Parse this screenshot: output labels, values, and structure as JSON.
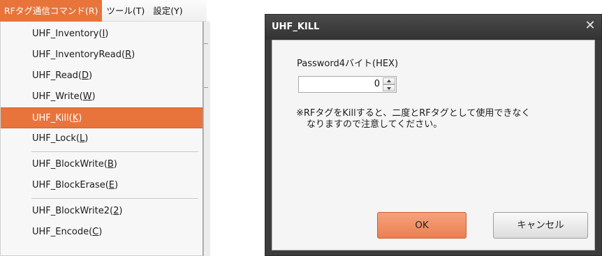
{
  "menubar": {
    "items": [
      {
        "label": "RFタグ通信コマンド(R)"
      },
      {
        "label": "ツール(T)"
      },
      {
        "label": "設定(Y)"
      }
    ]
  },
  "dropdown": {
    "items": [
      {
        "name": "UHF_Inventory(",
        "key": "I",
        "tail": ")"
      },
      {
        "name": "UHF_InventoryRead(",
        "key": "R",
        "tail": ")"
      },
      {
        "name": "UHF_Read(",
        "key": "D",
        "tail": ")"
      },
      {
        "name": "UHF_Write(",
        "key": "W",
        "tail": ")"
      },
      {
        "name": "UHF_Kill(",
        "key": "K",
        "tail": ")"
      },
      {
        "name": "UHF_Lock(",
        "key": "L",
        "tail": ")"
      },
      {
        "name": "UHF_BlockWrite(",
        "key": "B",
        "tail": ")"
      },
      {
        "name": "UHF_BlockErase(",
        "key": "E",
        "tail": ")"
      },
      {
        "name": "UHF_BlockWrite2(",
        "key": "2",
        "tail": ")"
      },
      {
        "name": "UHF_Encode(",
        "key": "C",
        "tail": ")"
      }
    ],
    "highlighted": "UHF_Kill(K)"
  },
  "dialog": {
    "title": "UHF_KILL",
    "close_glyph": "✕",
    "password_label": "Password4バイト(HEX)",
    "password_value": "0",
    "note_line1": "※RFタグをKillすると、二度とRFタグとして使用できなく",
    "note_line2": "なりますので注意してください。",
    "ok_label": "OK",
    "cancel_label": "キャンセル"
  },
  "colors": {
    "accent": "#e8743b",
    "dialog_frame": "#3c3c3c"
  }
}
